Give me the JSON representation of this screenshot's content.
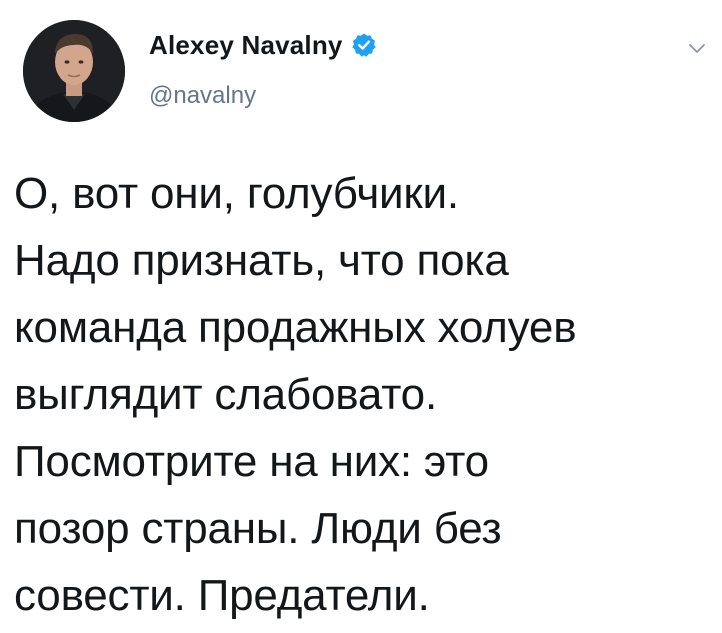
{
  "tweet": {
    "author": {
      "display_name": "Alexey Navalny",
      "handle": "@navalny",
      "verified": true,
      "avatar": "profile-photo"
    },
    "menu_icon": "chevron-down-icon",
    "text_lines": [
      "О, вот они, голубчики.",
      "Надо признать, что пока",
      "команда продажных холуев",
      "выглядит слабовато.",
      "Посмотрите на них: это",
      "позор страны. Люди без",
      "совести. Предатели."
    ]
  },
  "colors": {
    "verified_badge": "#1da1f2",
    "text": "#14171a",
    "secondary_text": "#657786",
    "caret": "#8899a6"
  }
}
